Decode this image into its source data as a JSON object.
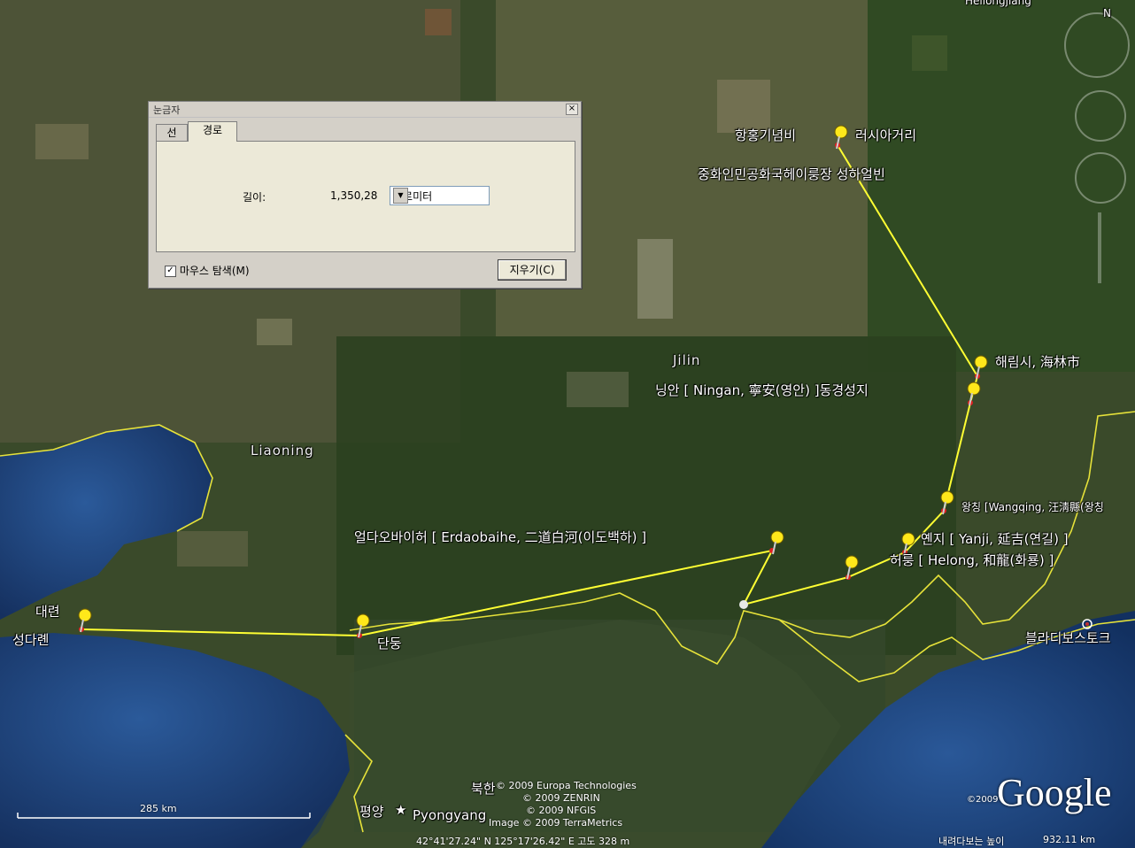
{
  "dialog": {
    "title": "눈금자",
    "tabs": [
      "선",
      "경로"
    ],
    "length_label": "길이:",
    "length_value": "1,350,28",
    "unit": "킬로미터",
    "mouse_nav_label": "마우스 탐색(M)",
    "clear_label": "지우기(C)"
  },
  "map": {
    "labels": {
      "top_edge": "Heilongjiang",
      "hanghong": "항홍기념비",
      "russia_street": "러시아거리",
      "harbin": "중화인민공화국헤이룽장 성하얼빈",
      "jilin": "Jilin",
      "hailin": "해림시, 海林市",
      "ningan": "닝안 [ Ningan, 寧安(영안) ]동경성지",
      "liaoning": "Liaoning",
      "wangqing": "왕칭 [Wangqing, 汪淸縣(왕칭",
      "yanji": "옌지 [ Yanji, 延吉(연길) ]",
      "helong": "허룽 [ Helong, 和龍(화룡) ]",
      "erdaobaihe": "얼다오바이허 [ Erdaobaihe, 二道白河(이도백하) ]",
      "dalian": "대련",
      "sdaren": "성다롄",
      "dandong": "단둥",
      "vladivostok": "블라디보스토크",
      "bukhan": "북한",
      "pyongyang_kr": "평양",
      "pyongyang_en": "Pyongyang"
    },
    "scale": "285 km",
    "copyrights": [
      "© 2009 Europa Technologies",
      "© 2009 ZENRIN",
      "© 2009 NFGIS",
      "Image © 2009 TerraMetrics"
    ],
    "google": "Google",
    "google_year": "©2009"
  },
  "status": {
    "coords": "42°41'27.24\" N  125°17'26.42\" E  고도  328 m",
    "eye_label": "내려다보는 높이",
    "eye_value": "932.11 km"
  },
  "colors": {
    "route": "#ffff33",
    "border": "#e6e23a",
    "sea": "#1e3d78"
  }
}
